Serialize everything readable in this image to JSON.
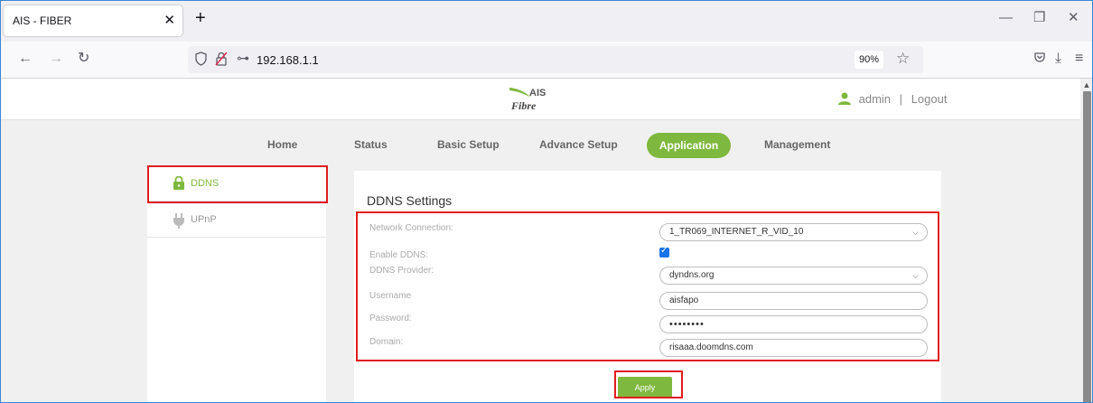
{
  "browser": {
    "tab_title": "AIS - FIBER",
    "url": "192.168.1.1",
    "zoom": "90%"
  },
  "header": {
    "logo_top": "AIS",
    "logo_bottom": "Fibre",
    "user": "admin",
    "separator": "|",
    "logout": "Logout"
  },
  "nav": {
    "home": "Home",
    "status": "Status",
    "basic_setup": "Basic Setup",
    "advance_setup": "Advance Setup",
    "application": "Application",
    "management": "Management",
    "active": "Application"
  },
  "sidebar": {
    "items": [
      {
        "label": "DDNS",
        "icon": "lock-icon",
        "active": true
      },
      {
        "label": "UPnP",
        "icon": "plug-icon",
        "active": false
      }
    ]
  },
  "ddns": {
    "title": "DDNS Settings",
    "network_connection_label": "Network Connection:",
    "network_connection_value": "1_TR069_INTERNET_R_VID_10",
    "enable_label": "Enable DDNS:",
    "enable_checked": true,
    "provider_label": "DDNS Provider:",
    "provider_value": "dyndns.org",
    "username_label": "Username",
    "username_value": "aisfapo",
    "password_label": "Password:",
    "password_value": "••••••••",
    "domain_label": "Domain:",
    "domain_value": "risaaa.doomdns.com",
    "apply_label": "Apply"
  },
  "colors": {
    "accent_green": "#7fb83e",
    "highlight_red": "#e01e1e",
    "checkbox_blue": "#1a73e8"
  }
}
